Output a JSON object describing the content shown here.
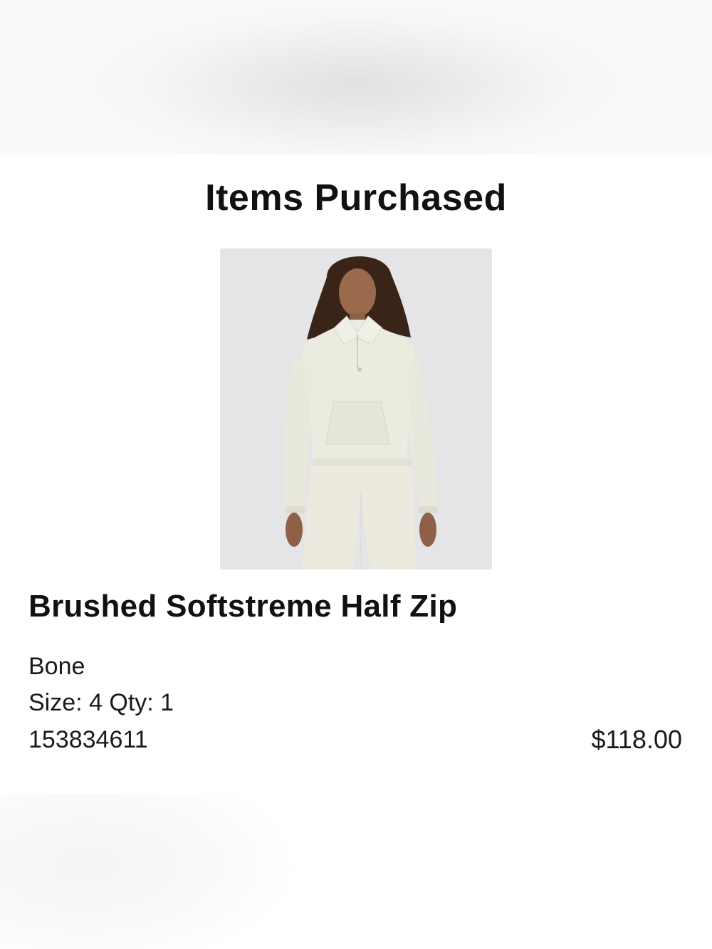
{
  "section": {
    "title": "Items Purchased"
  },
  "item": {
    "name": "Brushed Softstreme Half Zip",
    "color": "Bone",
    "size_qty": "Size: 4 Qty: 1",
    "sku": "153834611",
    "price": "$118.00",
    "image_icon": "product-photo-half-zip"
  },
  "colors": {
    "text": "#111111",
    "garment": "#ecebe0",
    "image_bg": "#e5e5e7"
  }
}
